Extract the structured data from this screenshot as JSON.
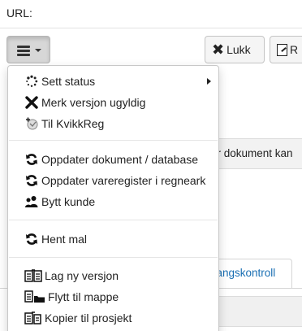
{
  "url_row": {
    "label": "URL:"
  },
  "toolbar": {
    "menu_icon": "hamburger-icon",
    "close_label": "Lukk",
    "partial_label": "R"
  },
  "background": {
    "bar_text": "år dokument kan",
    "tab_label": "gangskontroll"
  },
  "menu": {
    "items": [
      {
        "label": "Sett status",
        "icon": "spinner-icon",
        "has_submenu": true
      },
      {
        "label": "Merk versjon ugyldig",
        "icon": "x-mark-icon"
      },
      {
        "label": "Til KvikkReg",
        "icon": "kvikkreg-icon"
      },
      {
        "label": "Oppdater dokument / database",
        "icon": "refresh-icon"
      },
      {
        "label": "Oppdater vareregister i regneark",
        "icon": "refresh-icon"
      },
      {
        "label": "Bytt kunde",
        "icon": "users-icon"
      },
      {
        "label": "Hent mal",
        "icon": "refresh-icon"
      },
      {
        "label": "Lag ny versjon",
        "icon": "doc-copy-icon"
      },
      {
        "label": "Flytt til mappe",
        "icon": "doc-folder-icon"
      },
      {
        "label": "Kopier til prosjekt",
        "icon": "doc-copy-icon"
      }
    ]
  }
}
